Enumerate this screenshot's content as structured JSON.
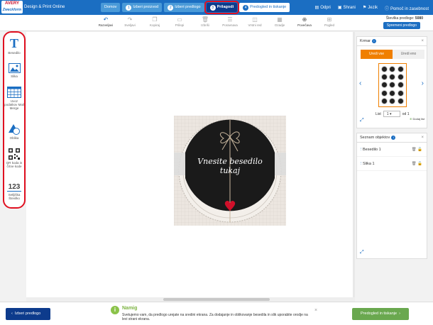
{
  "app": {
    "logo_line1": "AVERY",
    "logo_line2": "Zweckform",
    "title": "Design & Print Online"
  },
  "steps": [
    {
      "num": "",
      "label": "Domov"
    },
    {
      "num": "1",
      "label": "Izberi proizvod"
    },
    {
      "num": "2",
      "label": "Izberi predlogo"
    },
    {
      "num": "3",
      "label": "Prilagodi"
    },
    {
      "num": "4",
      "label": "Predogled in tiskanje"
    }
  ],
  "top_right": {
    "open": "Odpri",
    "save": "Shrani",
    "language": "Jezik",
    "help": "Pomoč in zasebnost"
  },
  "toolbar": {
    "undo": "Razveljavi",
    "redo": "Sveljavi",
    "copy": "Kopiraj",
    "paste": "Prilepi",
    "delete": "Izbriši",
    "align": "Poravnava",
    "order": "Vrstni red",
    "back": "Ozadje",
    "zoom": "Povečava",
    "view": "Pogled",
    "template_size_label": "Številka predloge:",
    "template_size_value": "5080",
    "change_template": "Spremeni predlogo"
  },
  "left_tools": [
    {
      "label": "Besedilo"
    },
    {
      "label": "Slika"
    },
    {
      "label": "Uvoz podatkov Mail Merge"
    },
    {
      "label": "Oblika"
    },
    {
      "label": "QR koda in črtne kode"
    },
    {
      "label": "Setljiška Številko"
    }
  ],
  "canvas": {
    "label_text": "Vnesite besedilo tukaj"
  },
  "thumb_panel": {
    "title": "Krmar",
    "tab_edit_all": "Uredi vse",
    "tab_edit_one": "Uredi eno",
    "sheet_label": "List",
    "sheet_value": "1",
    "sheet_of": "od 1",
    "add_sheet": "Dodaj list"
  },
  "objects_panel": {
    "title": "Seznam objektov",
    "items": [
      {
        "label": "Besedilo 1"
      },
      {
        "label": "Slika 1"
      }
    ]
  },
  "bottom": {
    "back_button": "Izberi predlogo",
    "tip_title": "Namig",
    "tip_text": "Svetujemo vam, da predlogo urejate na sredini ekrana. Za dodajanje in oblikovanje besedila in slik uporabite orodje na levi strani ekrana.",
    "next_button": "Predogled in tiskanje"
  },
  "colors": {
    "brand": "#1b6ec2",
    "active_step": "#0d3b8c",
    "highlight": "#e01020",
    "accent": "#f07f00",
    "go": "#6aa84f"
  }
}
